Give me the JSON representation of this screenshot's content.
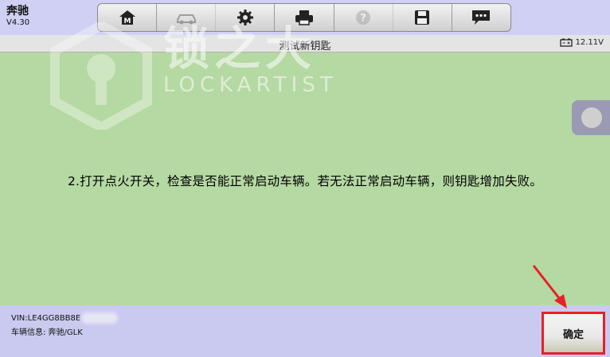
{
  "app": {
    "name": "奔驰",
    "version": "V4.30"
  },
  "toolbar": {
    "items": [
      {
        "icon": "home-icon"
      },
      {
        "icon": "car-icon",
        "disabled": true
      },
      {
        "icon": "gear-icon"
      },
      {
        "icon": "printer-icon"
      },
      {
        "icon": "help-icon",
        "disabled": true
      },
      {
        "icon": "save-icon"
      },
      {
        "icon": "message-icon"
      }
    ]
  },
  "header": {
    "title": "测试新钥匙",
    "battery": "12.11V"
  },
  "watermark": {
    "cn": "锁之大",
    "en": "LOCKARTIST"
  },
  "main": {
    "message": "2.打开点火开关，检查是否能正常启动车辆。若无法正常启动车辆，则钥匙增加失败。"
  },
  "footer": {
    "vin": "VIN:LE4GG8BB8E",
    "car_info": "车辆信息: 奔驰/GLK"
  },
  "actions": {
    "confirm": "确定"
  },
  "colors": {
    "content_bg": "#b5d9a2",
    "highlight": "#e8202a",
    "footer_bg": "#cacaf0"
  }
}
